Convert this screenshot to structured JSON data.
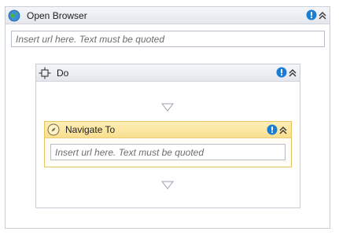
{
  "open_browser": {
    "title": "Open Browser",
    "url_placeholder": "Insert url here. Text must be quoted",
    "icons": {
      "activity": "globe-icon",
      "warning": "warning-icon",
      "collapse": "collapse-chevron-icon"
    }
  },
  "do_scope": {
    "title": "Do",
    "icons": {
      "activity": "scope-icon",
      "warning": "warning-icon",
      "collapse": "collapse-chevron-icon"
    }
  },
  "navigate_to": {
    "title": "Navigate To",
    "url_placeholder": "Insert url here. Text must be quoted",
    "icons": {
      "activity": "compass-icon",
      "warning": "warning-icon",
      "collapse": "collapse-chevron-icon"
    }
  },
  "drop_targets": [
    "drop-target-arrow",
    "drop-target-arrow"
  ],
  "colors": {
    "warning": "#1a7ed6",
    "selected_border": "#e6c65b",
    "selected_header": "#fbe6a2",
    "border": "#c9ced6"
  }
}
